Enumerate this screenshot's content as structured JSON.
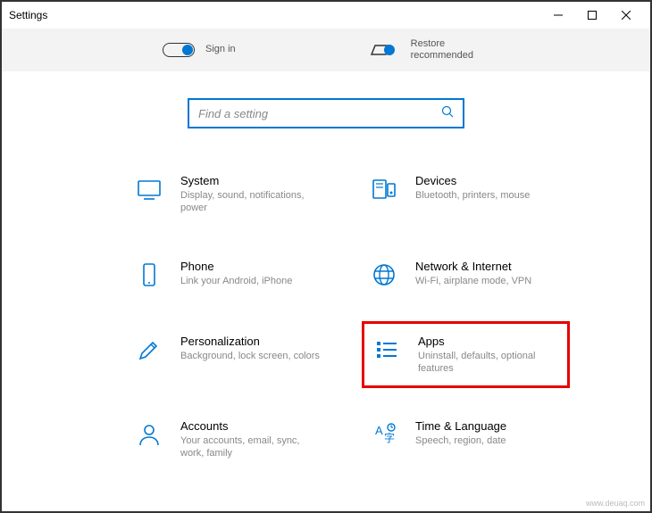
{
  "window": {
    "title": "Settings"
  },
  "top_band": {
    "sign_in": "Sign in",
    "restore": "Restore recommended"
  },
  "search": {
    "placeholder": "Find a setting"
  },
  "tiles": {
    "system": {
      "title": "System",
      "sub": "Display, sound, notifications, power"
    },
    "devices": {
      "title": "Devices",
      "sub": "Bluetooth, printers, mouse"
    },
    "phone": {
      "title": "Phone",
      "sub": "Link your Android, iPhone"
    },
    "network": {
      "title": "Network & Internet",
      "sub": "Wi-Fi, airplane mode, VPN"
    },
    "personalization": {
      "title": "Personalization",
      "sub": "Background, lock screen, colors"
    },
    "apps": {
      "title": "Apps",
      "sub": "Uninstall, defaults, optional features"
    },
    "accounts": {
      "title": "Accounts",
      "sub": "Your accounts, email, sync, work, family"
    },
    "time": {
      "title": "Time & Language",
      "sub": "Speech, region, date"
    }
  },
  "watermark": "www.deuaq.com"
}
